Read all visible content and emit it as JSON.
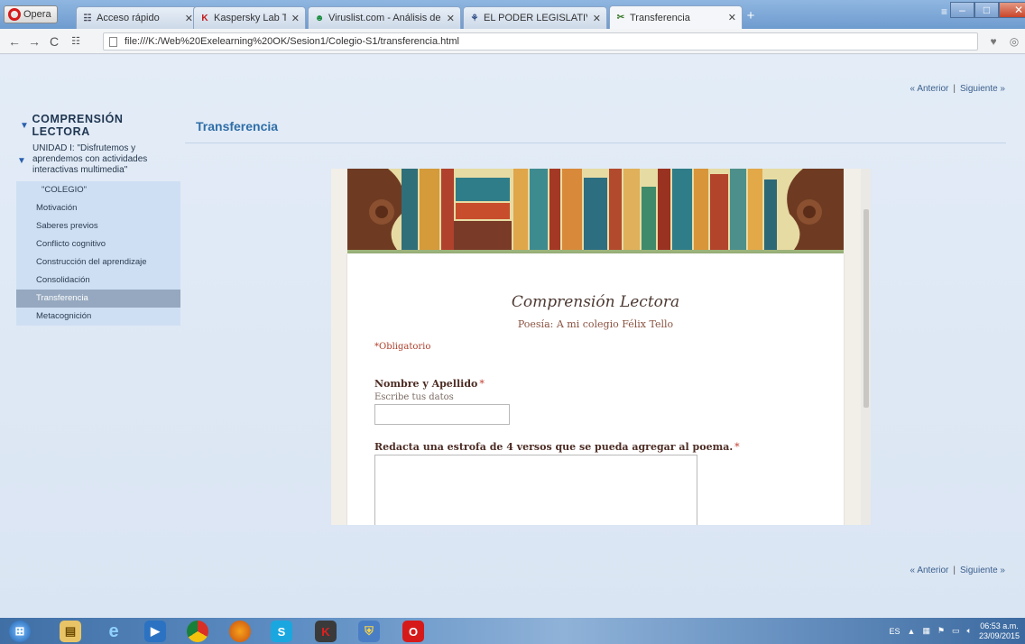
{
  "browser": {
    "menu_label": "Opera",
    "tabs": [
      {
        "label": "Acceso rápido",
        "icon": "grid-icon"
      },
      {
        "label": "Kaspersky Lab Technical S",
        "icon": "kaspersky-icon"
      },
      {
        "label": "Viruslist.com - Análisis de",
        "icon": "viruslist-icon"
      },
      {
        "label": "EL PODER LEGISLATIVO -",
        "icon": "legislativo-icon"
      },
      {
        "label": "Transferencia",
        "icon": "exelearning-icon"
      }
    ],
    "url": "file:///K:/Web%20Exelearning%20OK/Sesion1/Colegio-S1/transferencia.html"
  },
  "pager": {
    "prev": "« Anterior",
    "next": "Siguiente »",
    "separator": "|"
  },
  "nav": {
    "heading": "COMPRENSIÓN LECTORA",
    "unit": "UNIDAD I: \"Disfrutemos y aprendemos con actividades interactivas multimedia\"",
    "group": "\"COLEGIO\"",
    "items": [
      {
        "label": "Motivación",
        "active": false
      },
      {
        "label": "Saberes previos",
        "active": false
      },
      {
        "label": "Conflicto cognitivo",
        "active": false
      },
      {
        "label": "Construcción del aprendizaje",
        "active": false
      },
      {
        "label": "Consolidación",
        "active": false
      },
      {
        "label": "Transferencia",
        "active": true
      },
      {
        "label": "Metacognición",
        "active": false
      }
    ]
  },
  "content": {
    "title": "Transferencia"
  },
  "form": {
    "title": "Comprensión Lectora",
    "subtitle": "Poesía: A mi colegio Félix Tello",
    "required_note": "*Obligatorio",
    "q1_label": "Nombre y Apellido",
    "q1_help": "Escribe tus datos",
    "q2_label": "Redacta una estrofa de 4 versos que se pueda agregar al poema.",
    "required_mark": "*",
    "q1_value": "",
    "q2_value": ""
  },
  "taskbar": {
    "language": "ES",
    "time": "06:53 a.m.",
    "date": "23/09/2015"
  }
}
